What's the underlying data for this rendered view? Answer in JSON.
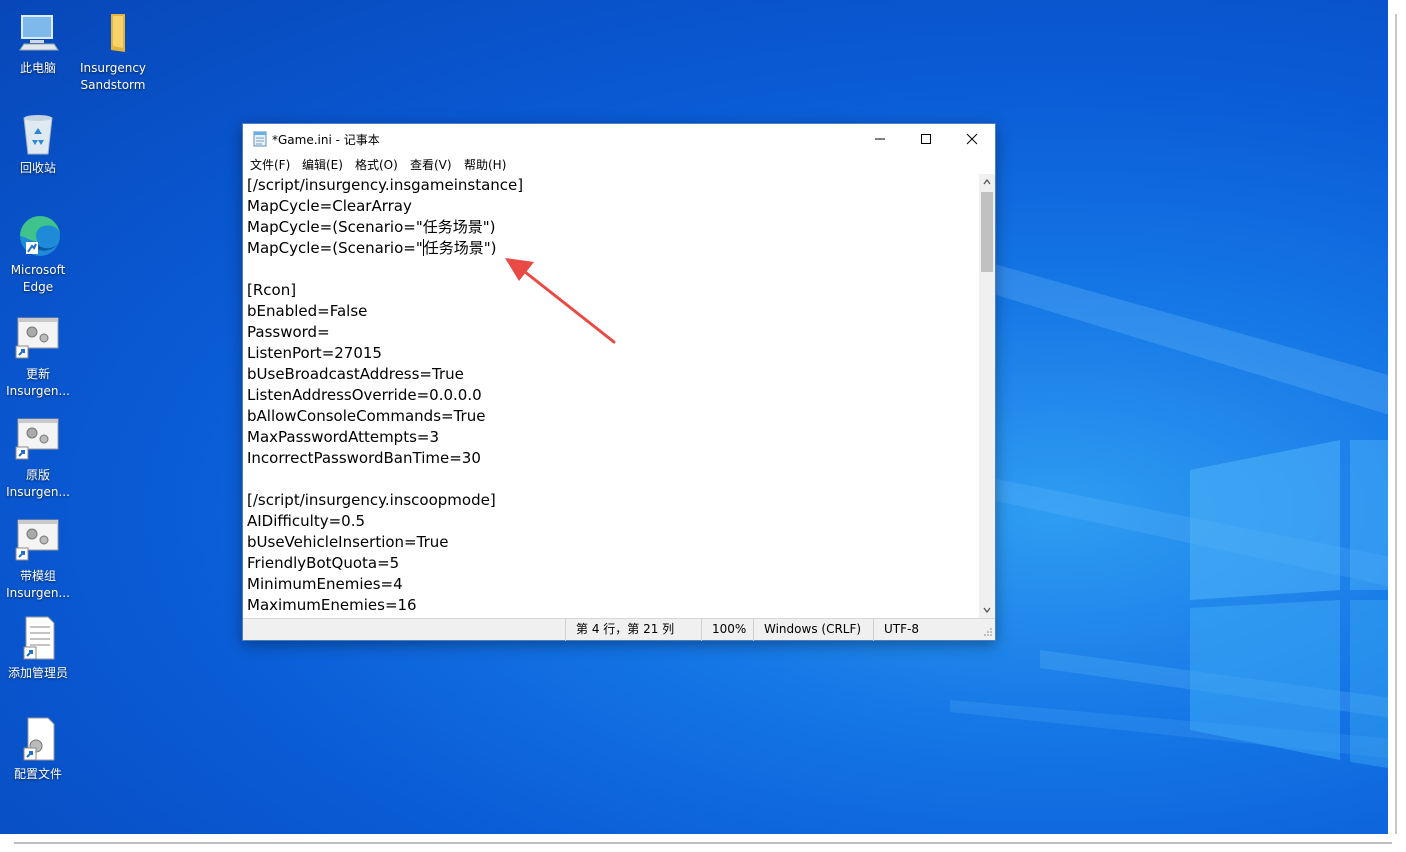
{
  "desktop": {
    "icons": [
      {
        "id": "this-pc",
        "label": "此电脑"
      },
      {
        "id": "insurgency-folder",
        "label": "Insurgency Sandstorm"
      },
      {
        "id": "recycle-bin",
        "label": "回收站"
      },
      {
        "id": "edge",
        "label": "Microsoft Edge"
      },
      {
        "id": "update",
        "label": "更新 Insurgen..."
      },
      {
        "id": "original",
        "label": "原版 Insurgen..."
      },
      {
        "id": "mod",
        "label": "带模组 Insurgen..."
      },
      {
        "id": "add-admin",
        "label": "添加管理员"
      },
      {
        "id": "config",
        "label": "配置文件"
      }
    ]
  },
  "notepad": {
    "title": "*Game.ini - 记事本",
    "menu": [
      "文件(F)",
      "编辑(E)",
      "格式(O)",
      "查看(V)",
      "帮助(H)"
    ],
    "lines": [
      "[/script/insurgency.insgameinstance]",
      "MapCycle=ClearArray",
      "MapCycle=(Scenario=\"任务场景\")",
      "MapCycle=(Scenario=\"",
      "",
      "[Rcon]",
      "bEnabled=False",
      "Password=",
      "ListenPort=27015",
      "bUseBroadcastAddress=True",
      "ListenAddressOverride=0.0.0.0",
      "bAllowConsoleCommands=True",
      "MaxPasswordAttempts=3",
      "IncorrectPasswordBanTime=30",
      "",
      "[/script/insurgency.inscoopmode]",
      "AIDifficulty=0.5",
      "bUseVehicleInsertion=True",
      "FriendlyBotQuota=5",
      "MinimumEnemies=4",
      "MaximumEnemies=16"
    ],
    "caret_line_suffix": "任务场景\")",
    "status": {
      "position": "第 4 行，第 21 列",
      "zoom": "100%",
      "line_ending": "Windows (CRLF)",
      "encoding": "UTF-8"
    }
  },
  "colors": {
    "annotation_arrow": "#ea4a44",
    "window_border": "#4a7fc1"
  }
}
